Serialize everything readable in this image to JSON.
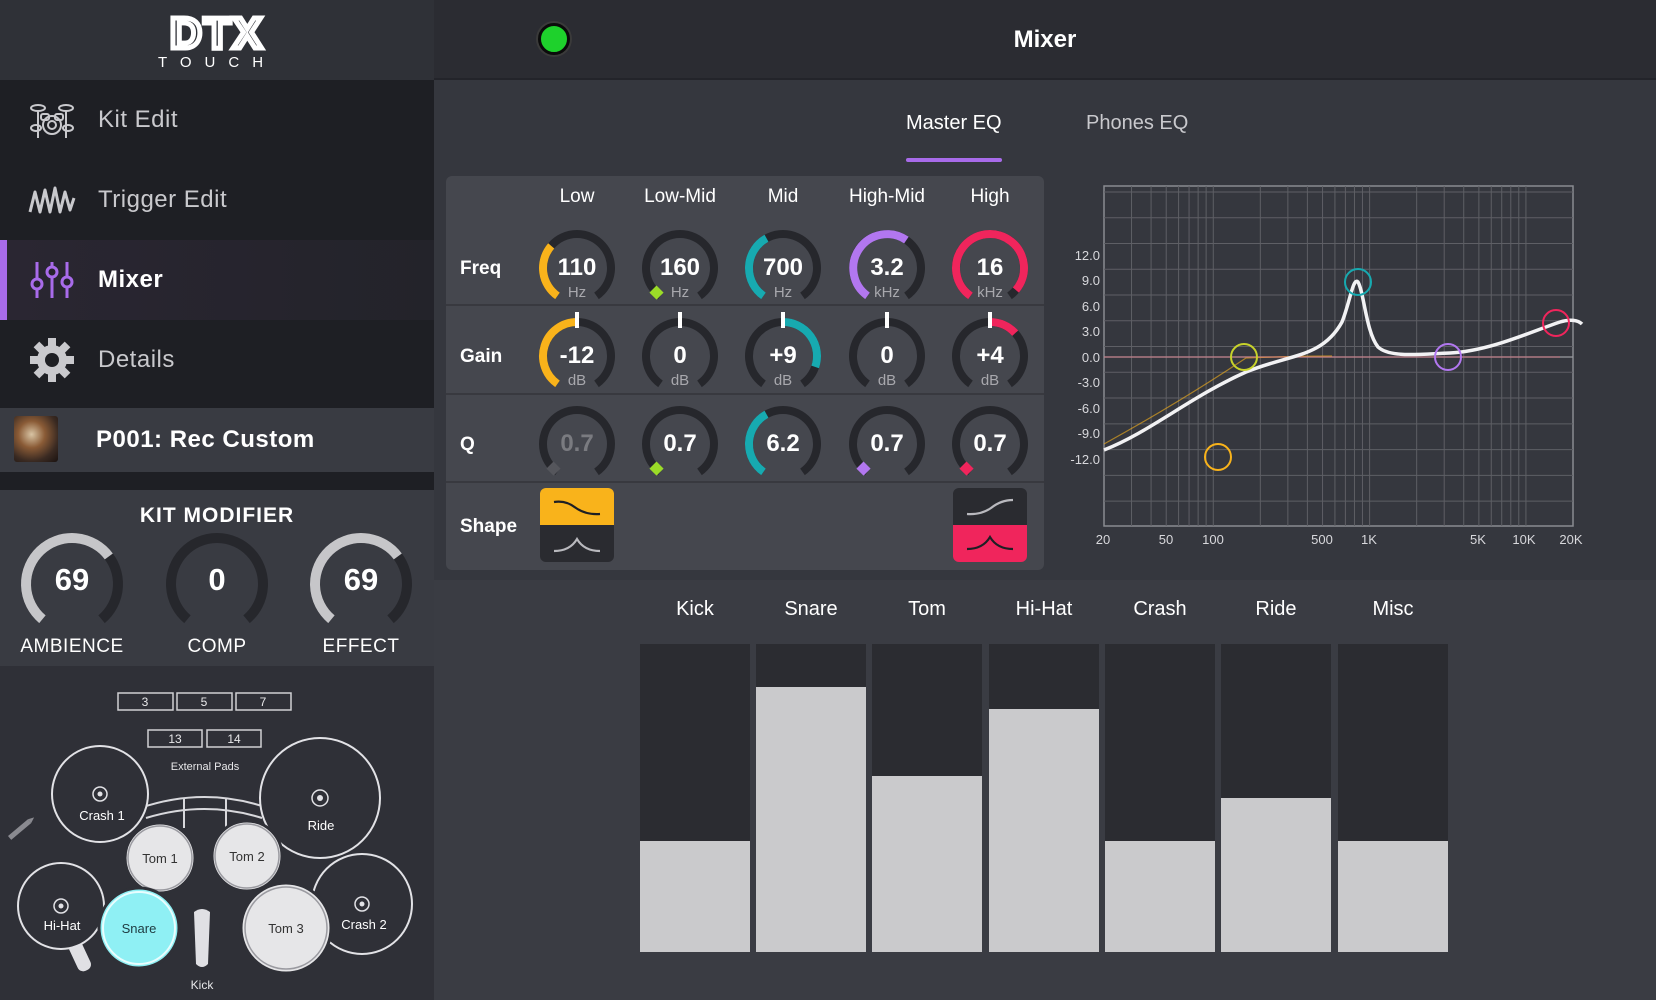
{
  "logo": {
    "main": "DTX",
    "sub": "TOUCH"
  },
  "nav": [
    {
      "label": "Kit Edit",
      "icon": "drum-kit-icon"
    },
    {
      "label": "Trigger Edit",
      "icon": "waveform-icon"
    },
    {
      "label": "Mixer",
      "icon": "sliders-icon"
    },
    {
      "label": "Details",
      "icon": "gear-icon"
    }
  ],
  "kit": {
    "name": "P001: Rec Custom"
  },
  "kit_modifier": {
    "title": "KIT MODIFIER",
    "knobs": [
      {
        "label": "AMBIENCE",
        "value": "69",
        "level": 0.69
      },
      {
        "label": "COMP",
        "value": "0",
        "level": 0
      },
      {
        "label": "EFFECT",
        "value": "69",
        "level": 0.69
      }
    ]
  },
  "pads": {
    "external_label": "External Pads",
    "boxes_top": [
      "3",
      "5",
      "7"
    ],
    "boxes_mid": [
      "13",
      "14"
    ],
    "crash1": "Crash 1",
    "ride": "Ride",
    "tom1": "Tom 1",
    "tom2": "Tom 2",
    "hihat": "Hi-Hat",
    "snare": "Snare",
    "tom3": "Tom 3",
    "crash2": "Crash 2",
    "kick": "Kick"
  },
  "header": {
    "title": "Mixer",
    "status_color": "#1ed12c"
  },
  "tabs": [
    {
      "label": "Master EQ",
      "active": true
    },
    {
      "label": "Phones EQ",
      "active": false
    }
  ],
  "eq": {
    "bands": [
      "Low",
      "Low-Mid",
      "Mid",
      "High-Mid",
      "High"
    ],
    "rows": {
      "freq": "Freq",
      "gain": "Gain",
      "q": "Q",
      "shape": "Shape"
    },
    "band_colors": [
      "#f9b31b",
      "#9bdc28",
      "#17aab0",
      "#b277f0",
      "#f0255c"
    ],
    "freq": [
      {
        "value": "110",
        "unit": "Hz",
        "level": 0.33
      },
      {
        "value": "160",
        "unit": "Hz",
        "level": 0.03
      },
      {
        "value": "700",
        "unit": "Hz",
        "level": 0.4
      },
      {
        "value": "3.2",
        "unit": "kHz",
        "level": 0.62
      },
      {
        "value": "16",
        "unit": "kHz",
        "level": 0.95
      }
    ],
    "gain": [
      {
        "value": "-12",
        "unit": "dB",
        "level": -1
      },
      {
        "value": "0",
        "unit": "dB",
        "level": 0
      },
      {
        "value": "+9",
        "unit": "dB",
        "level": 0.75
      },
      {
        "value": "0",
        "unit": "dB",
        "level": 0
      },
      {
        "value": "+4",
        "unit": "dB",
        "level": 0.33
      }
    ],
    "q": [
      {
        "value": "0.7",
        "level": 0.03,
        "disabled": true
      },
      {
        "value": "0.7",
        "level": 0.03
      },
      {
        "value": "6.2",
        "level": 0.4
      },
      {
        "value": "0.7",
        "level": 0.03
      },
      {
        "value": "0.7",
        "level": 0.03
      }
    ]
  },
  "graph": {
    "y_ticks": [
      "12.0",
      "9.0",
      "6.0",
      "3.0",
      "0.0",
      "-3.0",
      "-6.0",
      "-9.0",
      "-12.0"
    ],
    "x_ticks": [
      "20",
      "50",
      "100",
      "500",
      "1K",
      "5K",
      "10K",
      "20K"
    ]
  },
  "mixer": {
    "channels": [
      {
        "label": "Kick",
        "level": 0.36
      },
      {
        "label": "Snare",
        "level": 0.86
      },
      {
        "label": "Tom",
        "level": 0.57
      },
      {
        "label": "Hi-Hat",
        "level": 0.79
      },
      {
        "label": "Crash",
        "level": 0.36
      },
      {
        "label": "Ride",
        "level": 0.5
      },
      {
        "label": "Misc",
        "level": 0.36
      }
    ]
  }
}
